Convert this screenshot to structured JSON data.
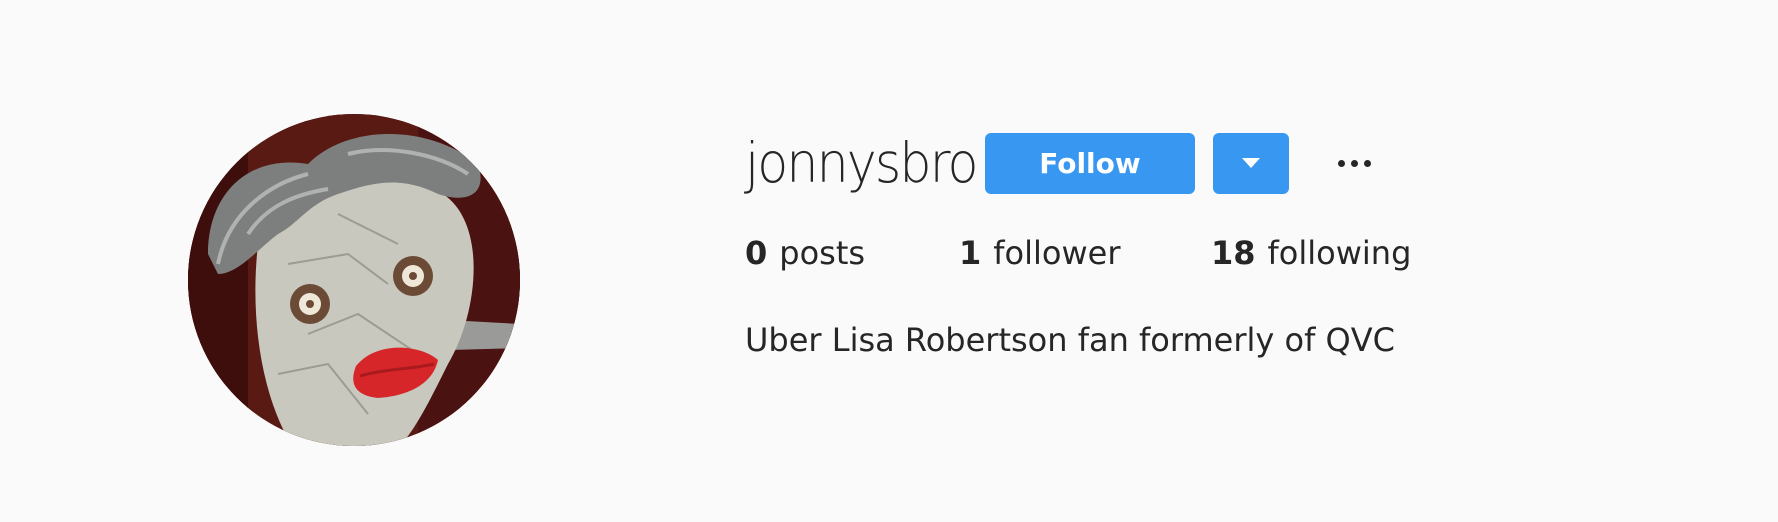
{
  "profile": {
    "username": "jonnysbro",
    "follow_label": "Follow",
    "dropdown_icon": "caret-down-icon",
    "more_icon": "more-options-icon",
    "stats": {
      "posts_count": "0",
      "posts_label": "posts",
      "followers_count": "1",
      "followers_label": "follower",
      "following_count": "18",
      "following_label": "following"
    },
    "bio": "Uber Lisa Robertson fan formerly of QVC"
  },
  "colors": {
    "accent": "#3897f0",
    "background": "#fafafa",
    "text": "#262626"
  }
}
